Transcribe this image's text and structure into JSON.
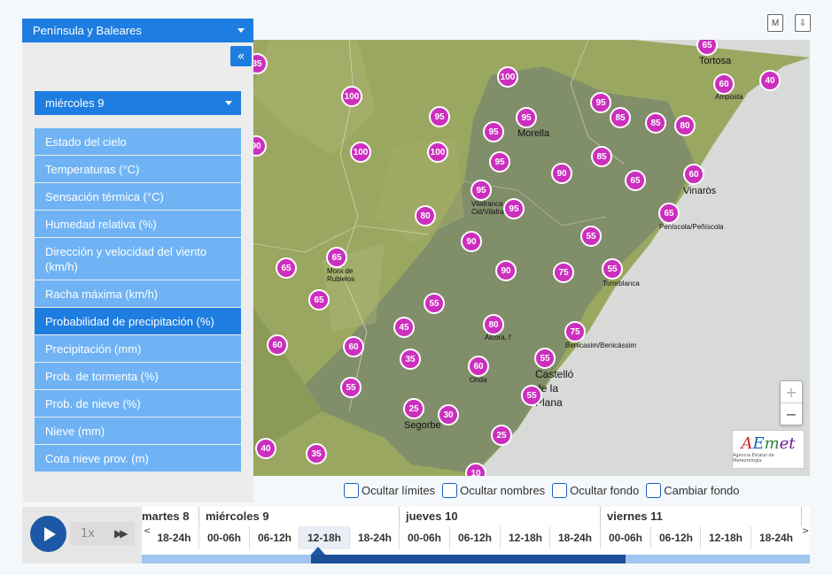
{
  "panel": {
    "region": "Península y Baleares",
    "collapse": "«",
    "day": "miércoles 9",
    "layers": [
      "Estado del cielo",
      "Temperaturas (°C)",
      "Sensación térmica (°C)",
      "Humedad relativa (%)",
      "Dirección y velocidad del viento (km/h)",
      "Racha máxima (km/h)",
      "Probabilidad de precipitación (%)",
      "Precipitación (mm)",
      "Prob. de tormenta (%)",
      "Prob. de nieve (%)",
      "Nieve (mm)",
      "Cota nieve prov. (m)"
    ],
    "active_layer": "Probabilidad de precipitación (%)"
  },
  "top_icons": {
    "m": "M",
    "download": "⇩"
  },
  "map": {
    "towns": {
      "tortosa": "Tortosa",
      "amposta": "Amposta",
      "morella": "Morella",
      "vinaros": "Vinaròs",
      "vilafranca": "Vilafranca del Cid/Vilafranca",
      "peniscola": "Peníscola/Peñíscola",
      "mora": "Mora de Rubielos",
      "torreblanca": "Torreblanca",
      "alcora": "Alcora, l'",
      "benicassim": "Benicasim/Benicàssim",
      "castello": "Castelló de la Plana",
      "onda": "Onda",
      "segorbe": "Segorbe"
    },
    "values": [
      "35",
      "65",
      "100",
      "60",
      "40",
      "95",
      "95",
      "95",
      "95",
      "85",
      "85",
      "80",
      "90",
      "100",
      "100",
      "95",
      "85",
      "90",
      "65",
      "60",
      "95",
      "80",
      "95",
      "65",
      "90",
      "55",
      "65",
      "65",
      "65",
      "90",
      "75",
      "55",
      "65",
      "55",
      "60",
      "45",
      "80",
      "75",
      "60",
      "35",
      "60",
      "55",
      "55",
      "55",
      "25",
      "30",
      "25",
      "40",
      "35",
      "10"
    ],
    "zoom_in": "+",
    "zoom_out": "−",
    "logo_text": "AEmet",
    "logo_sub": "Agencia Estatal de Meteorología"
  },
  "checkboxes": [
    "Ocultar límites",
    "Ocultar nombres",
    "Ocultar fondo",
    "Cambiar fondo"
  ],
  "timeline": {
    "speed": "1x",
    "fast_forward": "▶▶",
    "days": [
      "martes 8",
      "miércoles 9",
      "jueves 10",
      "viernes 11"
    ],
    "slots": [
      "18-24h",
      "00-06h",
      "06-12h",
      "12-18h",
      "18-24h",
      "00-06h",
      "06-12h",
      "12-18h",
      "18-24h",
      "00-06h",
      "06-12h",
      "12-18h",
      "18-24h"
    ],
    "current_slot": "12-18h",
    "left_arrow": "<",
    "right_arrow": ">"
  }
}
